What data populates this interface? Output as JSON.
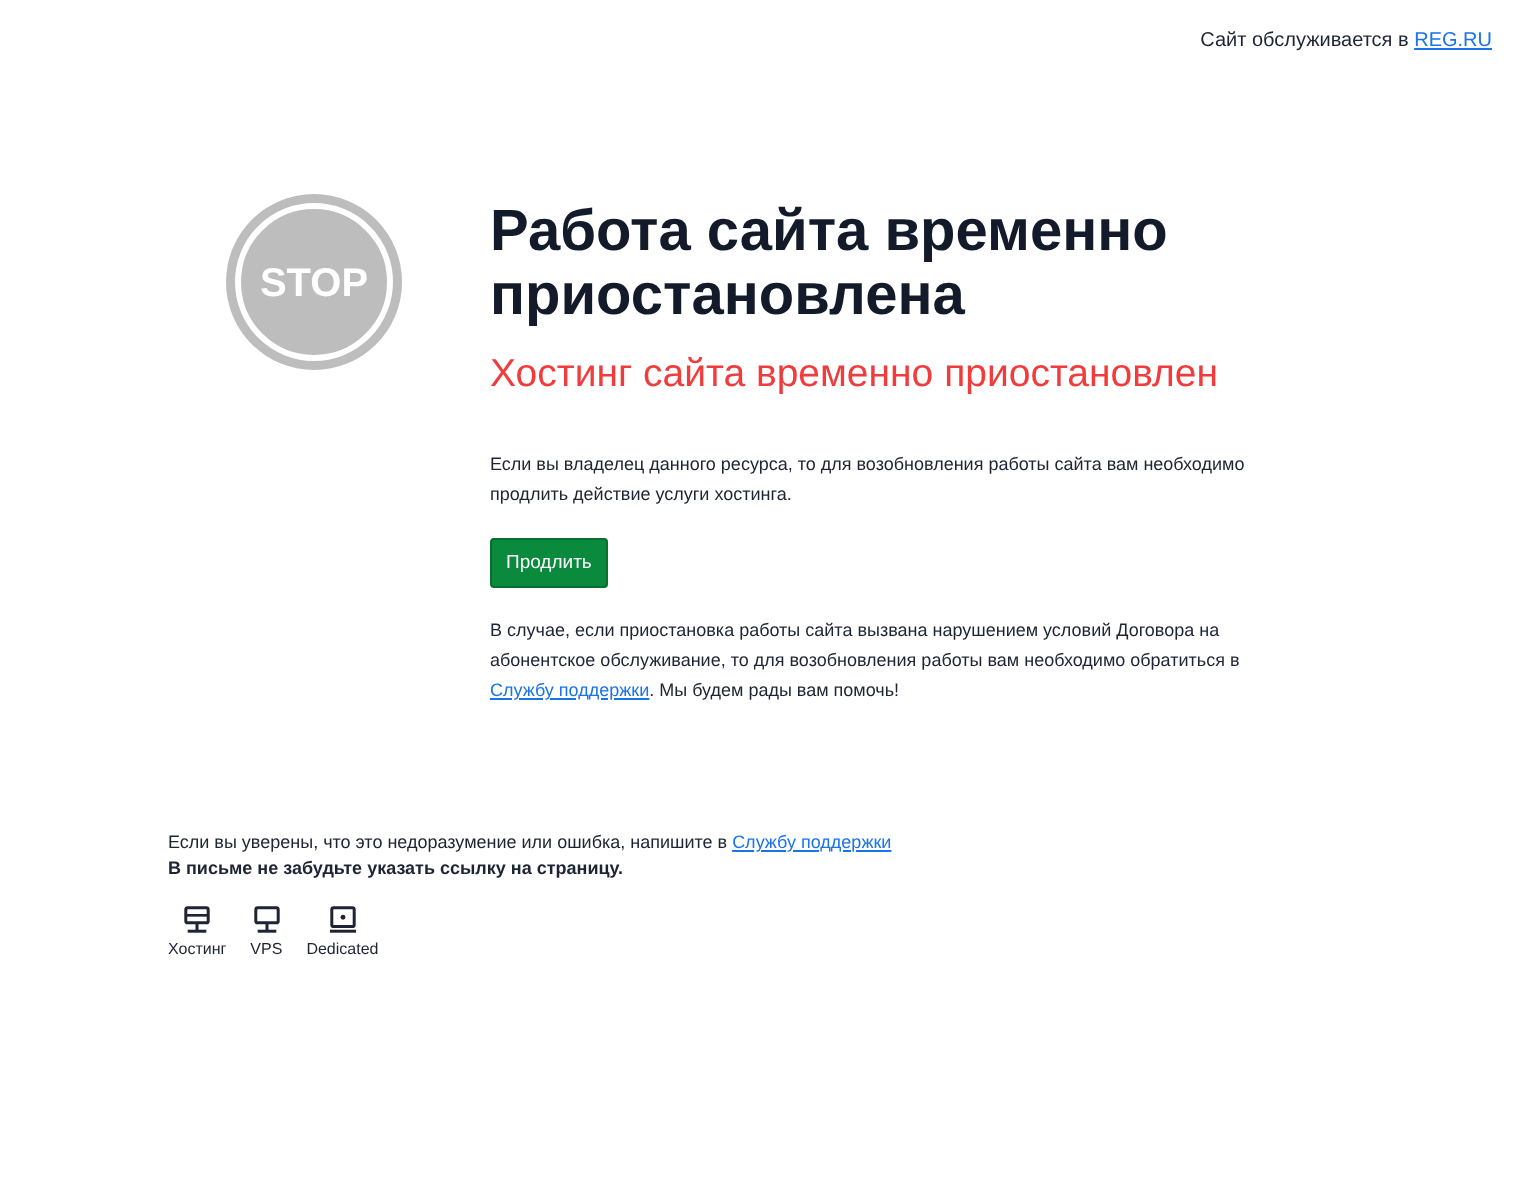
{
  "top_bar": {
    "text": "Сайт обслуживается в ",
    "link": "REG.RU"
  },
  "stop_sign": {
    "label": "STOP"
  },
  "title": "Работа сайта временно приостановлена",
  "subtitle": "Хостинг сайта временно приостановлен",
  "owner_text": "Если вы владелец данного ресурса, то для возобновления работы сайта вам необходимо продлить действие услуги хостинга.",
  "renew_button": "Продлить",
  "violation_text": {
    "before": "В случае, если приостановка работы сайта вызвана нарушением условий Договора на абонентское обслуживание, то для возобновления работы вам необходимо обратиться в ",
    "link": "Службу поддержки",
    "after": ". Мы будем рады вам помочь!"
  },
  "footer": {
    "before": "Если вы уверены, что это недоразумение или ошибка, напишите в ",
    "link": "Службу поддержки",
    "note": "В письме не забудьте указать ссылку на страницу."
  },
  "services": [
    {
      "kind": "hosting",
      "label": "Хостинг"
    },
    {
      "kind": "vps",
      "label": "VPS"
    },
    {
      "kind": "dedicated",
      "label": "Dedicated"
    }
  ]
}
